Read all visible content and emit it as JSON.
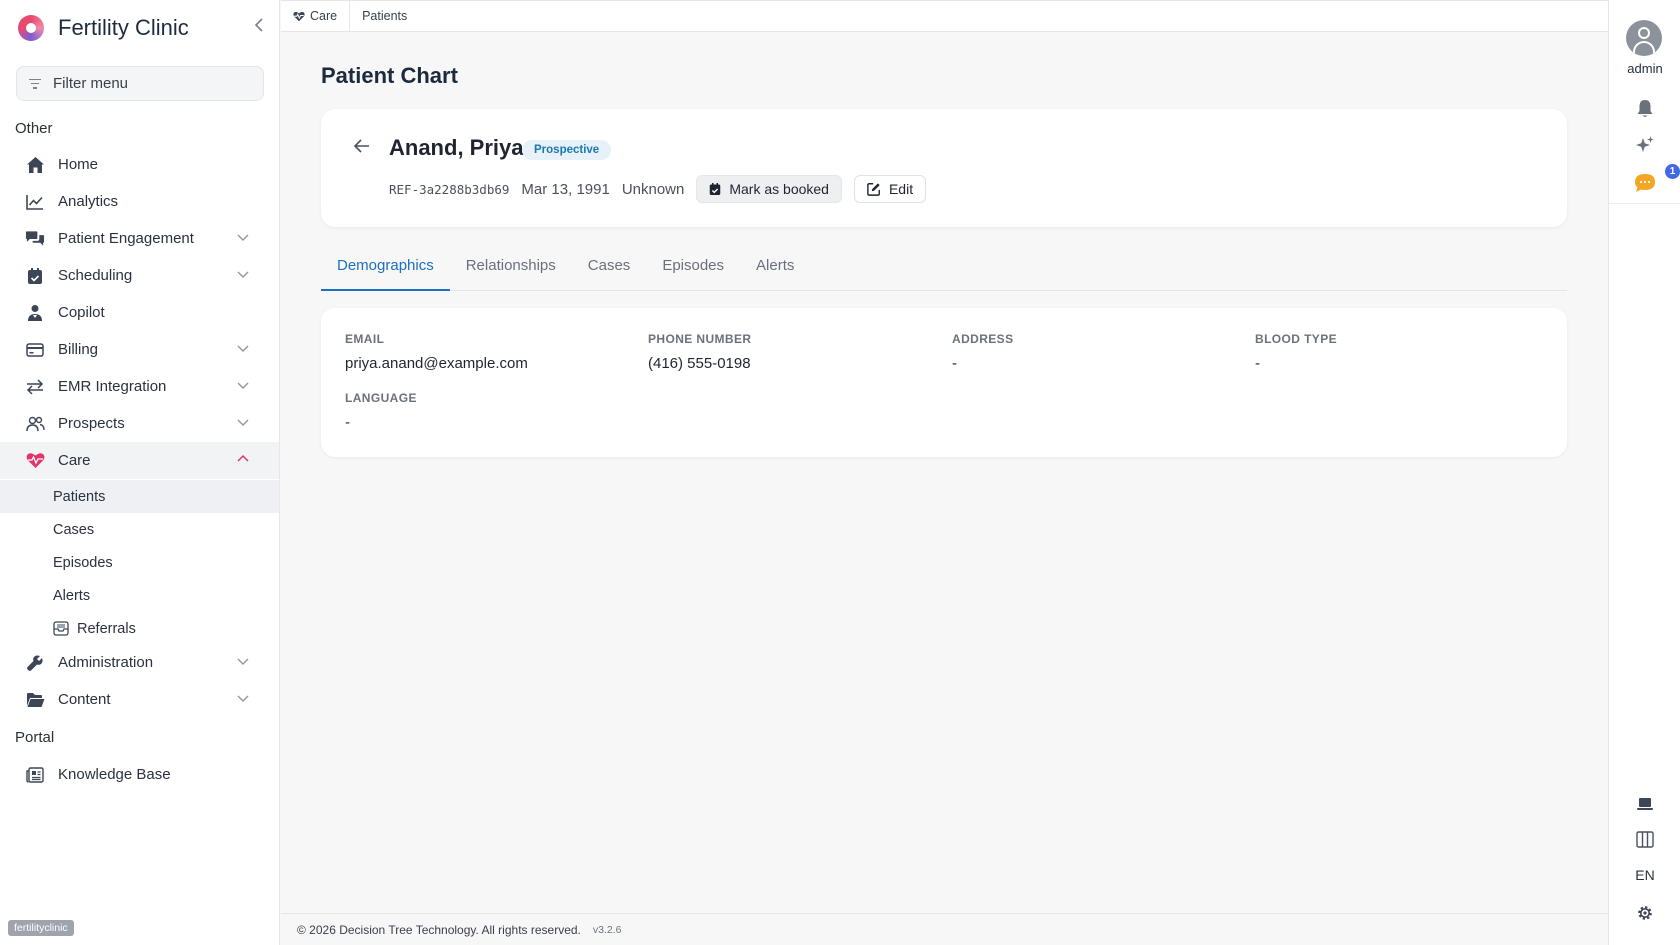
{
  "brand": {
    "name": "Fertility Clinic"
  },
  "sidebar": {
    "filter_placeholder": "Filter menu",
    "sections": {
      "other": "Other",
      "portal": "Portal"
    },
    "items": {
      "home": "Home",
      "analytics": "Analytics",
      "patient_engagement": "Patient Engagement",
      "scheduling": "Scheduling",
      "copilot": "Copilot",
      "billing": "Billing",
      "emr_integration": "EMR Integration",
      "prospects": "Prospects",
      "care": "Care",
      "administration": "Administration",
      "content": "Content",
      "knowledge_base": "Knowledge Base"
    },
    "care_sub": {
      "patients": "Patients",
      "cases": "Cases",
      "episodes": "Episodes",
      "alerts": "Alerts",
      "referrals": "Referrals"
    },
    "tenant": "fertilityclinic"
  },
  "breadcrumb": {
    "care": "Care",
    "patients": "Patients"
  },
  "page": {
    "title": "Patient Chart"
  },
  "patient": {
    "name": "Anand, Priya",
    "status": "Prospective",
    "ref": "REF-3a2288b3db69",
    "dob": "Mar 13, 1991",
    "sex": "Unknown",
    "mark_booked_label": "Mark as booked",
    "edit_label": "Edit"
  },
  "tabs": [
    "Demographics",
    "Relationships",
    "Cases",
    "Episodes",
    "Alerts"
  ],
  "demographics": {
    "email": {
      "label": "EMAIL",
      "value": "priya.anand@example.com"
    },
    "phone": {
      "label": "PHONE NUMBER",
      "value": "(416) 555-0198"
    },
    "address": {
      "label": "ADDRESS",
      "value": "-"
    },
    "blood_type": {
      "label": "BLOOD TYPE",
      "value": "-"
    },
    "language": {
      "label": "LANGUAGE",
      "value": "-"
    }
  },
  "footer": {
    "copyright": "© 2026 Decision Tree Technology. All rights reserved.",
    "version": "v3.2.6"
  },
  "rail": {
    "user": "admin",
    "chat_badge": "1",
    "language": "EN"
  },
  "colors": {
    "accent": "#1c6fc4",
    "care_icon": "#e0356a",
    "status_chip_bg": "#e6f1f8",
    "badge": "#4169e1",
    "chat": "#f5a524"
  }
}
